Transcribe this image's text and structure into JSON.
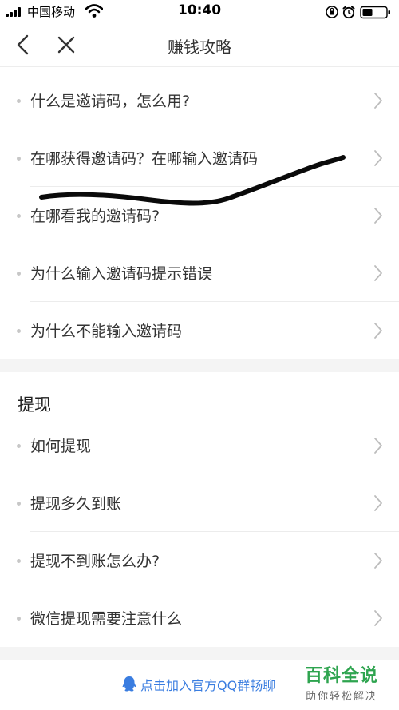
{
  "status_bar": {
    "carrier": "中国移动",
    "time": "10:40"
  },
  "nav": {
    "title": "赚钱攻略",
    "back_icon": "chevron-left-icon",
    "close_icon": "close-icon"
  },
  "invite_items": [
    {
      "label": "什么是邀请码，怎么用?"
    },
    {
      "label": "在哪获得邀请码？在哪输入邀请码"
    },
    {
      "label": "在哪看我的邀请码?"
    },
    {
      "label": "为什么输入邀请码提示错误"
    },
    {
      "label": "为什么不能输入邀请码"
    }
  ],
  "withdraw_section": {
    "title": "提现",
    "items": [
      {
        "label": "如何提现"
      },
      {
        "label": "提现多久到账"
      },
      {
        "label": "提现不到账怎么办?"
      },
      {
        "label": "微信提现需要注意什么"
      }
    ]
  },
  "footer": {
    "link_text": "点击加入官方QQ群畅聊",
    "watermark_main": "百科全说",
    "watermark_sub": "助你轻松解决"
  },
  "colors": {
    "link": "#3a7de0",
    "watermark": "#2ea44f",
    "band": "#f4f4f4"
  }
}
